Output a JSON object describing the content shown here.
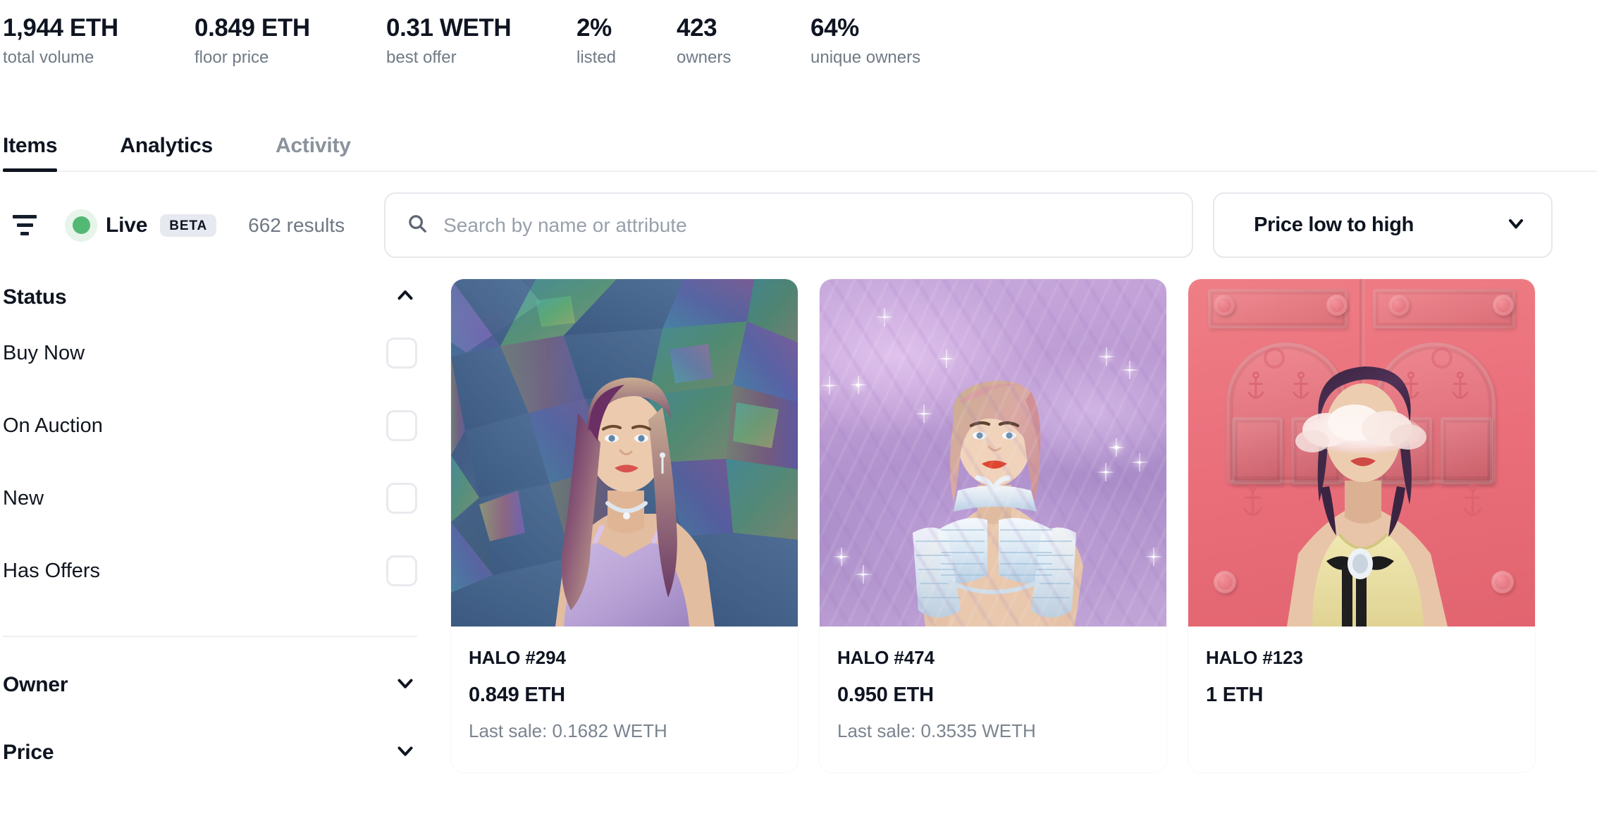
{
  "stats": [
    {
      "value": "1,944 ETH",
      "label": "total volume"
    },
    {
      "value": "0.849 ETH",
      "label": "floor price"
    },
    {
      "value": "0.31 WETH",
      "label": "best offer"
    },
    {
      "value": "2%",
      "label": "listed"
    },
    {
      "value": "423",
      "label": "owners"
    },
    {
      "value": "64%",
      "label": "unique owners"
    }
  ],
  "tabs": [
    {
      "label": "Items",
      "active": true
    },
    {
      "label": "Analytics",
      "active": false
    },
    {
      "label": "Activity",
      "active": false
    }
  ],
  "toolbar": {
    "filter_icon": "filter-icon",
    "live_label": "Live",
    "beta_badge": "BETA",
    "results_count": "662 results",
    "live_dot_color": "#53b873",
    "live_halo_color": "#e6f4ea",
    "search": {
      "icon": "search-icon",
      "placeholder": "Search by name or attribute",
      "value": ""
    },
    "sort": {
      "selected": "Price low to high",
      "icon": "chevron-down-icon"
    }
  },
  "sidebar": {
    "facets": [
      {
        "title": "Status",
        "expanded": true,
        "chevron": "chevron-up-icon",
        "options": [
          {
            "label": "Buy Now",
            "checked": false
          },
          {
            "label": "On Auction",
            "checked": false
          },
          {
            "label": "New",
            "checked": false
          },
          {
            "label": "Has Offers",
            "checked": false
          }
        ]
      },
      {
        "title": "Owner",
        "expanded": false,
        "chevron": "chevron-down-icon",
        "options": []
      },
      {
        "title": "Price",
        "expanded": false,
        "chevron": "chevron-down-icon",
        "options": []
      }
    ]
  },
  "grid": {
    "cards": [
      {
        "title": "HALO #294",
        "price": "0.849 ETH",
        "last_sale": "Last sale: 0.1682 WETH",
        "art": "holographic-shards-avatar"
      },
      {
        "title": "HALO #474",
        "price": "0.950 ETH",
        "last_sale": "Last sale: 0.3535 WETH",
        "art": "purple-caustics-avatar"
      },
      {
        "title": "HALO #123",
        "price": "1 ETH",
        "last_sale": "",
        "art": "pink-door-avatar"
      }
    ]
  }
}
